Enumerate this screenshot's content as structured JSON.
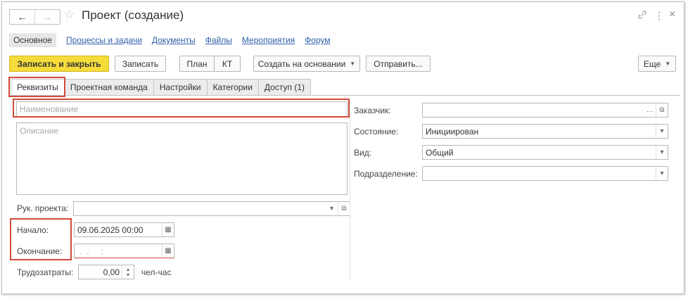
{
  "window": {
    "title": "Проект (создание)"
  },
  "icons": {
    "back": "arrow-left-icon",
    "forward": "arrow-right-icon",
    "favorite": "star-icon",
    "link": "link-icon",
    "more": "more-vertical-icon",
    "close": "close-icon"
  },
  "sections": {
    "active": "Основное",
    "links": [
      "Процессы и задачи",
      "Документы",
      "Файлы",
      "Мероприятия",
      "Форум"
    ]
  },
  "toolbar": {
    "save_close": "Записать и закрыть",
    "save": "Записать",
    "plan": "План",
    "kt": "КТ",
    "create_based": "Создать на основании",
    "send": "Отправить...",
    "more": "Еще"
  },
  "tabs": [
    "Реквизиты",
    "Проектная команда",
    "Настройки",
    "Категории",
    "Доступ (1)"
  ],
  "form": {
    "name_placeholder": "Наименование",
    "description_placeholder": "Описание",
    "manager_label": "Рук. проекта:",
    "manager_value": "",
    "start_label": "Начало:",
    "start_value": "09.06.2025 00:00",
    "end_label": "Окончание:",
    "end_value": " .  .     :",
    "labor_label": "Трудозатраты:",
    "labor_value": "0,00",
    "labor_unit": "чел-час",
    "customer_label": "Заказчик:",
    "customer_value": "",
    "state_label": "Состояние:",
    "state_value": "Инициирован",
    "kind_label": "Вид:",
    "kind_value": "Общий",
    "department_label": "Подразделение:",
    "department_value": ""
  },
  "colors": {
    "primary_button": "#f5dc3b",
    "link": "#2f5ea8",
    "highlight": "#d24b3a"
  }
}
